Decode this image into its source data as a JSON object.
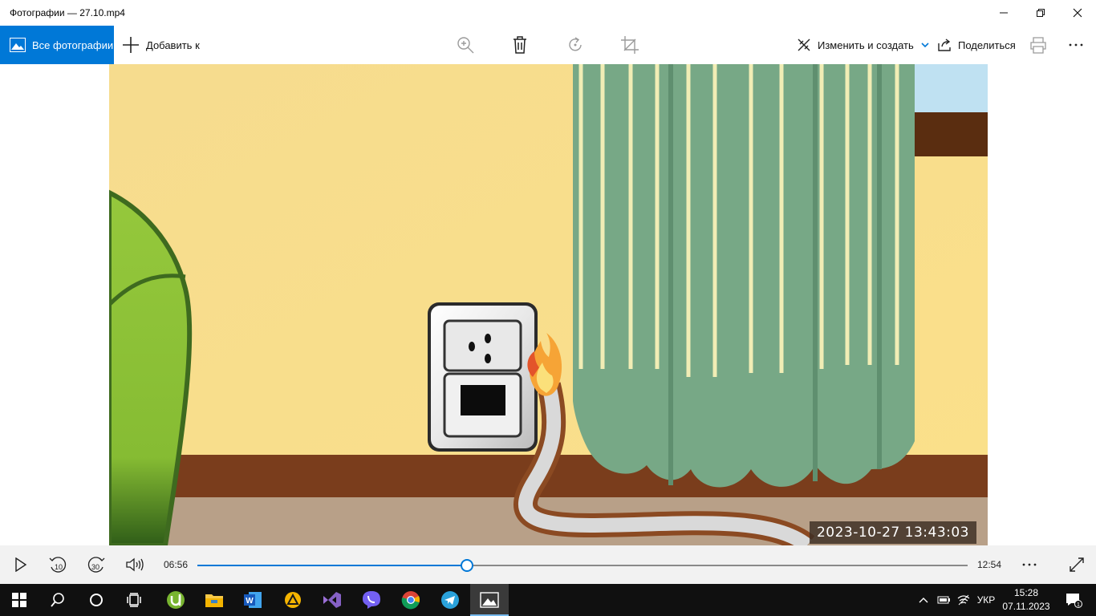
{
  "window": {
    "title": "Фотографии — 27.10.mp4"
  },
  "toolbar": {
    "all_photos_label": "Все фотографии",
    "add_to_label": "Добавить к",
    "edit_create_label": "Изменить и создать",
    "share_label": "Поделиться",
    "icons": [
      "zoom-icon",
      "delete-icon",
      "rotate-icon",
      "crop-icon",
      "print-icon",
      "more-icon"
    ]
  },
  "video": {
    "timestamp": "2023-10-27  13:43:03"
  },
  "player": {
    "current_time": "06:56",
    "total_time": "12:54",
    "progress_fraction": 0.35,
    "skip_back_label": "10",
    "skip_forward_label": "30"
  },
  "taskbar": {
    "apps": [
      "start",
      "search",
      "cortana",
      "task-view",
      "utorrent",
      "file-explorer",
      "word",
      "app-triangle",
      "visual-studio",
      "viber",
      "chrome",
      "telegram",
      "photos"
    ],
    "language": "УКР",
    "time": "15:28",
    "date": "07.11.2023",
    "notification_count": "1"
  },
  "colors": {
    "accent": "#0078d7",
    "taskbar": "#101010"
  }
}
